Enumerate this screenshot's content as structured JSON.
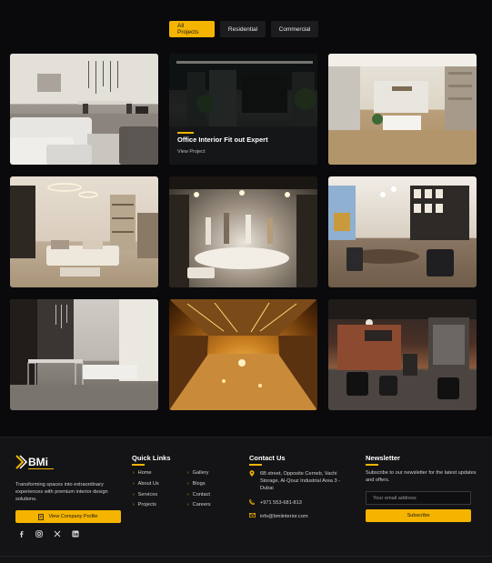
{
  "filters": [
    {
      "label": "All Projects",
      "active": true
    },
    {
      "label": "Residential",
      "active": false
    },
    {
      "label": "Commercial",
      "active": false
    }
  ],
  "gallery": {
    "hover_tile": {
      "title": "Office Interior Fit out Expert",
      "link": "View Project"
    }
  },
  "footer": {
    "logo_text": "BMi",
    "tagline": "Transforming spaces into extraordinary experiences with premium interior design solutions.",
    "profile_button": "View Company Profile",
    "socials": [
      "facebook-icon",
      "instagram-icon",
      "x-icon",
      "linkedin-icon"
    ],
    "quick_links": {
      "title": "Quick Links",
      "col1": [
        "Home",
        "About Us",
        "Services",
        "Projects"
      ],
      "col2": [
        "Gallery",
        "Blogs",
        "Contact",
        "Careers"
      ]
    },
    "contact": {
      "title": "Contact Us",
      "address": "6B street, Opposite Cerneb, Vachi Storage, Al-Qouz Industrial Area 3 - Dubai",
      "phone": "+971 553-681-813",
      "email": "info@bmiinterior.com"
    },
    "newsletter": {
      "title": "Newsletter",
      "text": "Subscribe to our newsletter for the latest updates and offers.",
      "placeholder": "Your email address",
      "button": "Subscribe"
    }
  },
  "colors": {
    "accent": "#f4b400",
    "background": "#0a0a0c",
    "footer_bg": "#141416"
  }
}
